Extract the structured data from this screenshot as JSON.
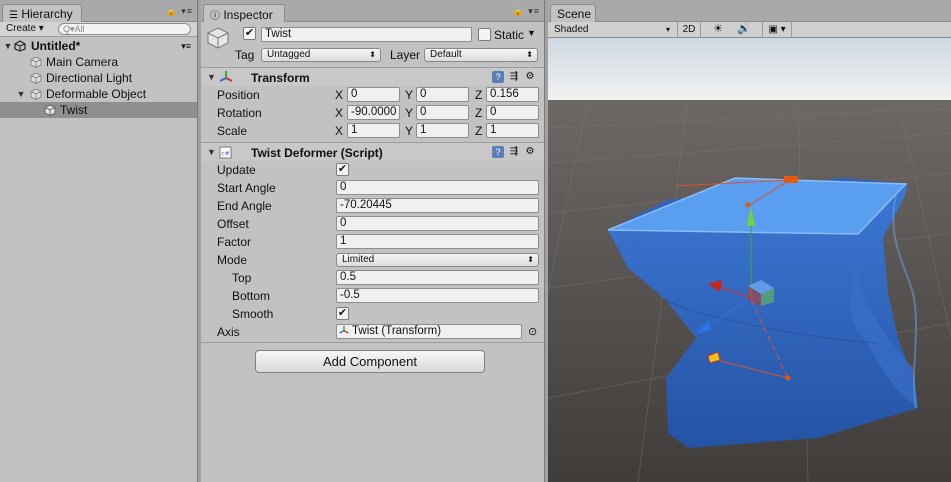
{
  "hierarchy": {
    "tab_title": "Hierarchy",
    "create_label": "Create",
    "search_placeholder": "All",
    "scene_name": "Untitled*",
    "items": [
      {
        "label": "Main Camera"
      },
      {
        "label": "Directional Light"
      },
      {
        "label": "Deformable Object"
      },
      {
        "label": "Twist"
      }
    ]
  },
  "inspector": {
    "tab_title": "Inspector",
    "object_name": "Twist",
    "active": true,
    "static_label": "Static",
    "tag_label": "Tag",
    "tag_value": "Untagged",
    "layer_label": "Layer",
    "layer_value": "Default",
    "transform": {
      "title": "Transform",
      "position_label": "Position",
      "rotation_label": "Rotation",
      "scale_label": "Scale",
      "axis_x": "X",
      "axis_y": "Y",
      "axis_z": "Z",
      "position": {
        "x": "0",
        "y": "0",
        "z": "0.156"
      },
      "rotation": {
        "x": "-90.0000",
        "y": "0",
        "z": "0"
      },
      "scale": {
        "x": "1",
        "y": "1",
        "z": "1"
      }
    },
    "twist": {
      "title": "Twist Deformer (Script)",
      "update_label": "Update",
      "update_checked": true,
      "start_angle_label": "Start Angle",
      "start_angle": "0",
      "end_angle_label": "End Angle",
      "end_angle": "-70.20445",
      "offset_label": "Offset",
      "offset": "0",
      "factor_label": "Factor",
      "factor": "1",
      "mode_label": "Mode",
      "mode": "Limited",
      "top_label": "Top",
      "top": "0.5",
      "bottom_label": "Bottom",
      "bottom": "-0.5",
      "smooth_label": "Smooth",
      "smooth_checked": true,
      "axis_label": "Axis",
      "axis_value": "Twist (Transform)"
    },
    "add_component_label": "Add Component"
  },
  "scene": {
    "tab_title": "Scene",
    "shading_mode": "Shaded",
    "mode_2d": "2D"
  },
  "colors": {
    "mesh_top": "#5a9ef0",
    "mesh_side": "#2f63b8",
    "gizmo_x": "#d4321c",
    "gizmo_y": "#6fd13a",
    "gizmo_z": "#2a72e8"
  }
}
